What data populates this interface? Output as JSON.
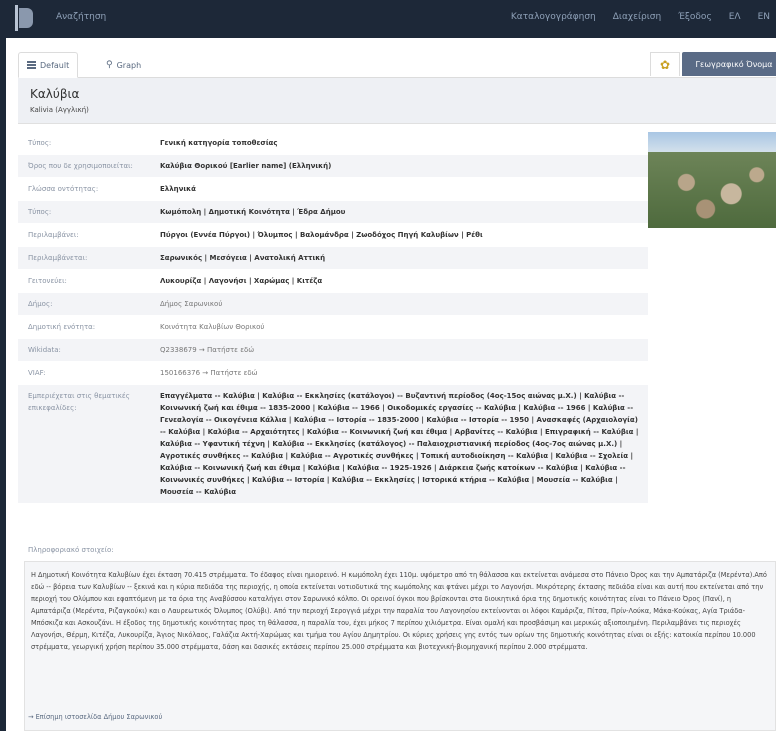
{
  "nav": {
    "search": "Αναζήτηση",
    "items": [
      "Καταλογογράφηση",
      "Διαχείριση",
      "Έξοδος",
      "ΕΛ",
      "EN"
    ]
  },
  "tabs": {
    "default": "Default",
    "graph": "Graph"
  },
  "geo_button": "Γεωγραφικό Όνομα",
  "title": "Καλύβια",
  "subtitle": "Kalivia (Αγγλική)",
  "properties": [
    {
      "key": "Τύπος:",
      "value": "Γενική κατηγορία τοποθεσίας",
      "plain": false
    },
    {
      "key": "Όρος που δε χρησιμοποιείται:",
      "value": "Καλύβια Θορικού [Earlier name] (Ελληνική)",
      "plain": false
    },
    {
      "key": "Γλώσσα οντότητας:",
      "value": "Ελληνικά",
      "plain": false
    },
    {
      "key": "Τύπος:",
      "value": "Κωμόπολη | Δημοτική Κοινότητα | Έδρα Δήμου",
      "plain": false
    },
    {
      "key": "Περιλαμβάνει:",
      "value": "Πύργοι (Εννέα Πύργοι) | Όλυμπος | Βαλομάνδρα | Ζωοδόχος Πηγή Καλυβίων | Ρέθι",
      "plain": false
    },
    {
      "key": "Περιλαμβάνεται:",
      "value": "Σαρωνικός | Μεσόγεια | Ανατολική Αττική",
      "plain": false
    },
    {
      "key": "Γειτονεύει:",
      "value": "Λυκουρίζα | Λαγονήσι | Χαρώμας | Κιτέζα",
      "plain": false
    },
    {
      "key": "Δήμος:",
      "value": "Δήμος Σαρωνικού",
      "plain": true
    },
    {
      "key": "Δημοτική ενότητα:",
      "value": "Κοινότητα Καλυβίων Θορικού",
      "plain": true
    },
    {
      "key": "Wikidata:",
      "value": "Q2338679 → Πατήστε εδώ",
      "plain": true
    },
    {
      "key": "VIAF:",
      "value": "150166376 → Πατήστε εδώ",
      "plain": true
    },
    {
      "key": "Εμπεριέχεται στις θεματικές επικεφαλίδες:",
      "value": "Επαγγέλματα -- Καλύβια | Καλύβια -- Εκκλησίες (κατάλογοι) -- Βυζαντινή περίοδος (4ος-15ος αιώνας μ.Χ.) | Καλύβια -- Κοινωνική ζωή και έθιμα -- 1835-2000 | Καλύβια -- 1966 | Οικοδομικές εργασίες -- Καλύβια | Καλύβια -- 1966 | Καλύβια -- Γενεαλογία -- Οικογένεια Κάλλια | Καλύβια -- Ιστορία -- 1835-2000 | Καλύβια -- Ιστορία -- 1950 | Ανασκαφές (Αρχαιολογία) -- Καλύβια | Καλύβια -- Αρχαιότητες | Καλύβια -- Κοινωνική ζωή και έθιμα | Αρβανίτες -- Καλύβια | Επιγραφική -- Καλύβια | Καλύβια -- Υφαντική τέχνη | Καλύβια -- Εκκλησίες (κατάλογος) -- Παλαιοχριστιανική περίοδος (4ος-7ος αιώνας μ.Χ.) | Αγροτικές συνθήκες -- Καλύβια | Καλύβια -- Αγροτικές συνθήκες | Τοπική αυτοδιοίκηση -- Καλύβια | Καλύβια -- Σχολεία | Καλύβια -- Κοινωνική ζωή και έθιμα | Καλύβια | Καλύβια -- 1925-1926 | Διάρκεια ζωής κατοίκων -- Καλύβια | Καλύβια -- Κοινωνικές συνθήκες | Καλύβια -- Ιστορία | Καλύβια -- Εκκλησίες | Ιστορικά κτήρια -- Καλύβια | Μουσεία -- Καλύβια | Μουσεία -- Καλύβια",
      "plain": false
    }
  ],
  "info_title": "Πληροφοριακό στοιχείο:",
  "info_text": "Η Δημοτική Κοινότητα Καλυβίων έχει έκταση 70.415 στρέμματα. Το έδαφος είναι ημιορεινό. Η κωμόπολη έχει 110μ. υψόμετρο από τη θάλασσα και εκτείνεται ανάμεσα στο Πάνειο Όρος και την Αμπατάριζα (Μερέντα).Από εδώ -- βόρεια των Καλυβίων -- ξεκινά και η κύρια πεδιάδα της περιοχής, η οποία εκτείνεται νοτιοδυτικά της κωμόπολης και φτάνει μέχρι το Λαγονήσι. Μικρότερης έκτασης πεδιάδα είναι και αυτή που εκτείνεται από την περιοχή του Ολύμπου και εφαπτόμενη με τα όρια της Αναβύσσου καταλήγει στον Σαρωνικό κόλπο. Οι ορεινοί όγκοι που βρίσκονται στα διοικητικά όρια της δημοτικής κοινότητας είναι το Πάνειο Όρος (Πανί), η Αμπατάριζα (Μερέντα, Ριζαγκούκι) και ο Λαυρεωτικός Όλυμπος (Ολύβι). Από την περιοχή Σερογγιά μέχρι την παραλία του Λαγονησίου εκτείνονται οι λόφοι Καμάριζα, Πίτσα, Πρίν-Λούκα, Μάκα-Κούκας, Αγία Τριάδα- Μπόσκιζα και Ασκουζάνι. Η έξοδος της δημοτικής κοινότητας προς τη θάλασσα, η παραλία του, έχει μήκος 7 περίπου χιλιόμετρα. Είναι ομαλή και προσβάσιμη και μερικώς αξιοποιημένη. Περιλαμβάνει τις περιοχές Λαγονήσι, Θέρμη, Κιτέζα, Λυκουρίζα, Άγιος Νικόλαος, Γαλάζια Ακτή-Χαρώμας και τμήμα του Αγίου Δημητρίου. Οι κύριες χρήσεις γης εντός των ορίων της δημοτικής κοινότητας είναι οι εξής: κατοικία περίπου 10.000 στρέμματα, γεωργική χρήση περίπου 35.000 στρέμματα, δάση και δασικές εκτάσεις περίπου 25.000 στρέμματα και βιοτεχνική-βιομηχανική περίπου 2.000 στρέμματα.",
  "info_link": "→ Επίσημη ιστοσελίδα Δήμου Σαρωνικού",
  "icons": {
    "logo": "logo-icon",
    "list": "list-icon",
    "graph": "graph-icon",
    "geo": "geo-search-icon"
  },
  "colors": {
    "topbar": "#1d2838",
    "accent": "#5a6b86"
  }
}
